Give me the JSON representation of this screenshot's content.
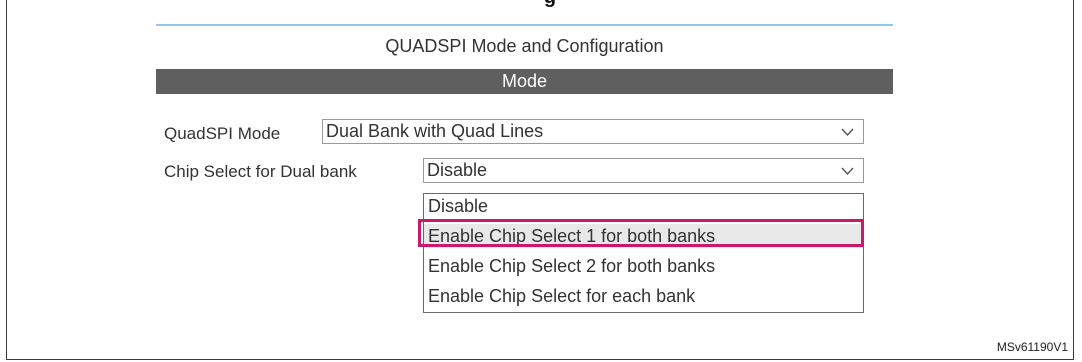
{
  "page": {
    "top_caption_fragment": "g",
    "reference_id": "MSv61190V1"
  },
  "panel": {
    "title": "QUADSPI Mode and Configuration",
    "section": "Mode"
  },
  "fields": {
    "quadspi_mode": {
      "label": "QuadSPI Mode",
      "value": "Dual Bank with Quad Lines"
    },
    "chip_select": {
      "label": "Chip Select for Dual bank",
      "value": "Disable"
    }
  },
  "dropdown": {
    "options": [
      {
        "label": "Disable"
      },
      {
        "label": "Enable Chip Select 1 for both banks",
        "highlighted": true
      },
      {
        "label": "Enable Chip Select 2 for both banks"
      },
      {
        "label": "Enable Chip Select for each bank"
      }
    ]
  },
  "colors": {
    "highlight_border": "#c8196e",
    "section_bar": "#5f5f5f",
    "accent_line": "#8fc9e6"
  },
  "icons": {
    "select_arrow": "chevron-down-icon"
  }
}
